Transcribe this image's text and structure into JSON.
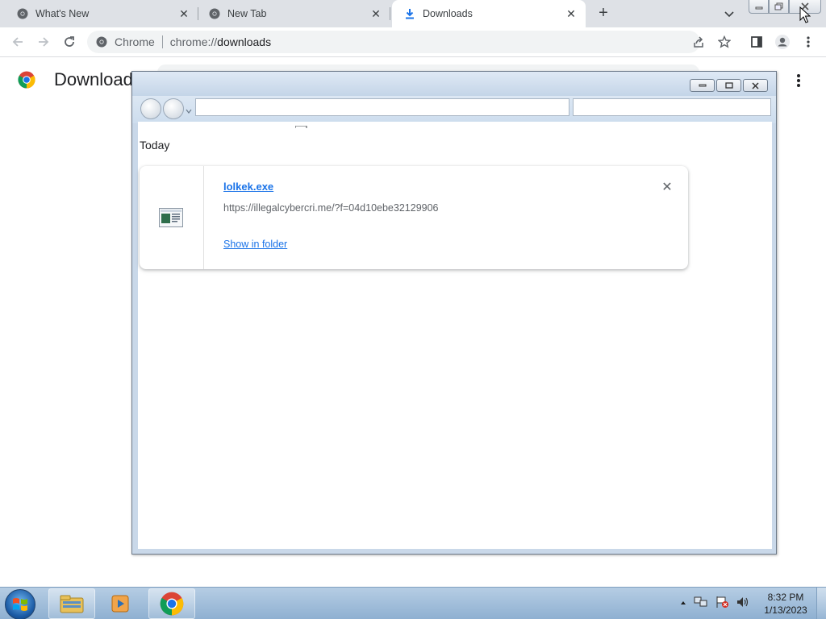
{
  "browser": {
    "tabs": [
      {
        "title": "What's New",
        "icon": "chrome-icon",
        "active": false
      },
      {
        "title": "New Tab",
        "icon": "chrome-icon",
        "active": false
      },
      {
        "title": "Downloads",
        "icon": "download-icon",
        "active": true
      }
    ],
    "omnibox": {
      "site_name": "Chrome",
      "url_scheme": "chrome://",
      "url_host": "downloads"
    }
  },
  "downloads_page": {
    "title": "Downloads",
    "section_label": "Today",
    "items": [
      {
        "file_name": "lolkek.exe",
        "source_url": "https://illegalcybercri.me/?f=04d10ebe32129906",
        "action_label": "Show in folder"
      }
    ]
  },
  "taskbar": {
    "time": "8:32 PM",
    "date": "1/13/2023",
    "pinned": [
      "explorer-icon",
      "media-player-icon",
      "chrome-icon"
    ]
  },
  "colors": {
    "accent_link": "#1a73e8",
    "tabstrip_bg": "#dee1e6",
    "taskbar_bg": "#a3bfdc"
  }
}
